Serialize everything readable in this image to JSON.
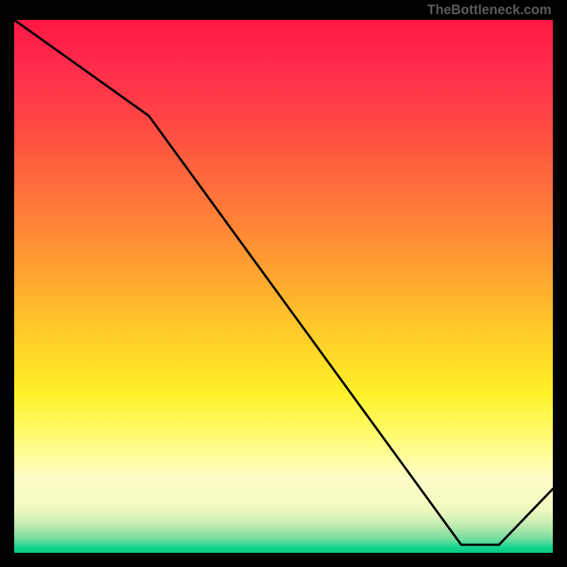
{
  "watermark": "TheBottleneck.com",
  "chart_data": {
    "type": "line",
    "title": "",
    "xlabel": "",
    "ylabel": "",
    "x": [
      0,
      0.25,
      0.83,
      0.9,
      1.0
    ],
    "y": [
      1.0,
      0.82,
      0.015,
      0.015,
      0.12
    ],
    "xlim": [
      0,
      1
    ],
    "ylim": [
      0,
      1
    ],
    "gradient": {
      "top": "#ff1744",
      "mid": "#ffd028",
      "bottom": "#05c97f"
    },
    "annotations": [
      {
        "text": "",
        "x": 0.845,
        "y": 0.035
      }
    ]
  }
}
